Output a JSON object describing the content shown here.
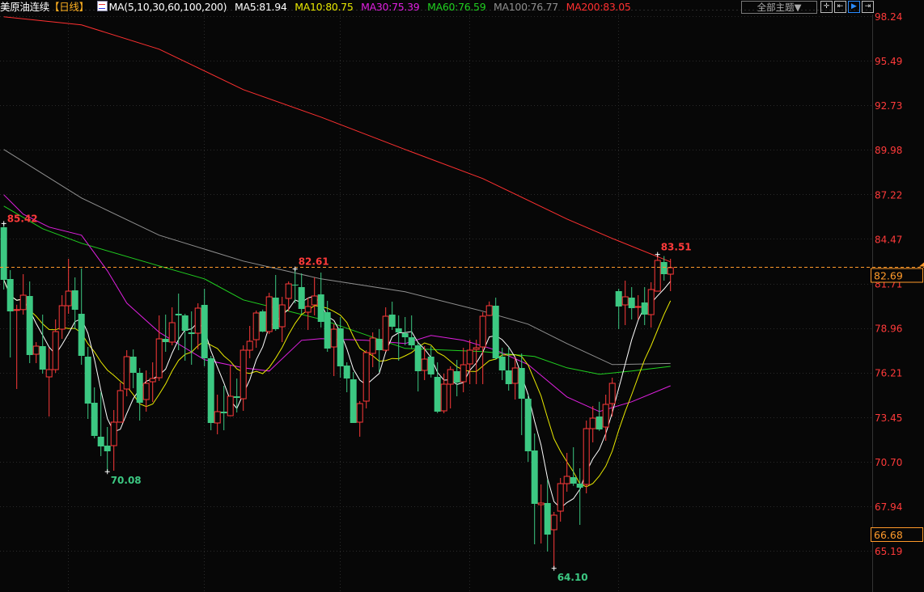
{
  "header": {
    "instrument": "美原油连续",
    "period": "【日线】",
    "ma_icon": "ma-indicator-icon",
    "ma_params": "MA(5,10,30,60,100,200)",
    "ma5": "MA5:81.94",
    "ma10": "MA10:80.75",
    "ma30": "MA30:75.39",
    "ma60": "MA60:76.59",
    "ma100": "MA100:76.77",
    "ma200": "MA200:83.05"
  },
  "toolbar": {
    "theme_label": "全部主题▼",
    "buttons": [
      {
        "icon": "crosshair-icon",
        "glyph": "✛"
      },
      {
        "icon": "fit-range-icon",
        "glyph": "⇤"
      },
      {
        "icon": "play-forward-icon",
        "glyph": "▶"
      },
      {
        "icon": "jump-to-end-icon",
        "glyph": "⇥"
      }
    ]
  },
  "colors": {
    "up": "#ff3a3a",
    "down": "#3cc882",
    "ma5": "#ffffff",
    "ma10": "#e8e800",
    "ma30": "#e020e0",
    "ma60": "#20d020",
    "ma100": "#909090",
    "ma200": "#ff3030",
    "axis": "#ff3a3a",
    "current": "#ff9a2a"
  },
  "chart_data": {
    "type": "candlestick",
    "yticks": [
      "98.24",
      "95.49",
      "92.73",
      "89.98",
      "87.22",
      "84.47",
      "81.71",
      "78.96",
      "76.21",
      "73.45",
      "70.70",
      "67.94",
      "65.19"
    ],
    "ylim": [
      64.0,
      98.24
    ],
    "grid": true,
    "current_price": "82.69",
    "current_line_value": 82.74,
    "marker_price": "66.68",
    "annotations": [
      {
        "text": "85.42",
        "index": 0,
        "value": 85.42,
        "kind": "high"
      },
      {
        "text": "70.08",
        "index": 16,
        "value": 70.08,
        "kind": "low"
      },
      {
        "text": "82.61",
        "index": 45,
        "value": 82.61,
        "kind": "high"
      },
      {
        "text": "64.10",
        "index": 85,
        "value": 64.1,
        "kind": "low"
      },
      {
        "text": "83.51",
        "index": 101,
        "value": 83.51,
        "kind": "high"
      }
    ],
    "ohlc": [
      [
        85.19,
        85.42,
        81.34,
        81.94
      ],
      [
        81.99,
        82.54,
        77.14,
        79.99
      ],
      [
        80.1,
        80.4,
        75.19,
        80.1
      ],
      [
        80.1,
        82.29,
        79.79,
        80.99
      ],
      [
        80.94,
        81.84,
        76.79,
        77.29
      ],
      [
        77.34,
        78.09,
        76.79,
        77.84
      ],
      [
        77.84,
        79.79,
        76.14,
        76.39
      ],
      [
        75.94,
        77.74,
        73.49,
        76.39
      ],
      [
        76.39,
        79.49,
        76.19,
        78.74
      ],
      [
        78.89,
        80.99,
        78.29,
        80.34
      ],
      [
        80.34,
        83.24,
        79.84,
        81.24
      ],
      [
        81.29,
        82.09,
        78.89,
        80.09
      ],
      [
        79.84,
        82.64,
        76.69,
        77.24
      ],
      [
        77.19,
        77.79,
        73.34,
        74.29
      ],
      [
        74.34,
        75.29,
        72.14,
        72.29
      ],
      [
        72.24,
        74.99,
        71.04,
        71.64
      ],
      [
        71.69,
        72.84,
        70.08,
        71.34
      ],
      [
        71.69,
        73.89,
        70.14,
        73.14
      ],
      [
        73.14,
        75.59,
        73.14,
        75.09
      ],
      [
        75.19,
        77.59,
        74.74,
        77.19
      ],
      [
        77.19,
        77.64,
        75.24,
        76.19
      ],
      [
        76.19,
        76.49,
        73.24,
        74.34
      ],
      [
        74.54,
        76.34,
        73.79,
        75.54
      ],
      [
        75.64,
        76.84,
        74.39,
        75.84
      ],
      [
        75.89,
        79.74,
        75.69,
        78.29
      ],
      [
        78.29,
        79.79,
        77.49,
        78.09
      ],
      [
        78.09,
        80.24,
        77.89,
        79.29
      ],
      [
        79.84,
        81.09,
        77.59,
        79.74
      ],
      [
        79.74,
        79.84,
        76.94,
        78.79
      ],
      [
        78.69,
        79.99,
        76.69,
        78.59
      ],
      [
        78.64,
        80.49,
        77.64,
        80.19
      ],
      [
        80.39,
        81.39,
        76.59,
        77.09
      ],
      [
        77.09,
        77.24,
        72.64,
        73.09
      ],
      [
        73.09,
        74.84,
        72.39,
        73.79
      ],
      [
        73.79,
        75.39,
        72.64,
        73.69
      ],
      [
        73.54,
        76.64,
        73.5,
        74.74
      ],
      [
        74.74,
        75.84,
        73.74,
        74.64
      ],
      [
        74.59,
        77.89,
        73.84,
        77.59
      ],
      [
        77.59,
        79.09,
        77.09,
        78.14
      ],
      [
        78.24,
        80.04,
        77.74,
        79.89
      ],
      [
        79.99,
        80.1,
        78.7,
        78.74
      ],
      [
        78.74,
        81.14,
        78.59,
        80.89
      ],
      [
        80.84,
        82.24,
        78.79,
        78.89
      ],
      [
        79.04,
        80.89,
        78.09,
        80.39
      ],
      [
        80.79,
        81.84,
        79.99,
        81.69
      ],
      [
        81.64,
        82.61,
        80.49,
        81.59
      ],
      [
        81.49,
        82.34,
        79.84,
        80.14
      ],
      [
        79.94,
        80.84,
        78.84,
        80.29
      ],
      [
        80.39,
        82.09,
        79.74,
        80.94
      ],
      [
        81.04,
        82.39,
        78.99,
        79.34
      ],
      [
        79.94,
        80.64,
        77.49,
        77.69
      ],
      [
        77.79,
        79.19,
        75.99,
        78.89
      ],
      [
        78.94,
        79.64,
        75.89,
        76.59
      ],
      [
        76.64,
        76.84,
        74.99,
        75.84
      ],
      [
        75.79,
        76.24,
        73.09,
        73.09
      ],
      [
        73.14,
        74.44,
        72.24,
        74.29
      ],
      [
        74.44,
        77.59,
        73.99,
        77.44
      ],
      [
        77.39,
        78.69,
        76.54,
        78.34
      ],
      [
        78.29,
        78.89,
        76.24,
        77.59
      ],
      [
        77.59,
        80.24,
        77.5,
        79.69
      ],
      [
        79.79,
        80.59,
        78.84,
        79.04
      ],
      [
        78.94,
        79.74,
        76.94,
        78.69
      ],
      [
        78.64,
        79.64,
        77.9,
        78.39
      ],
      [
        78.39,
        79.74,
        77.7,
        77.89
      ],
      [
        77.89,
        78.04,
        75.04,
        76.29
      ],
      [
        76.34,
        77.84,
        75.74,
        77.04
      ],
      [
        77.19,
        77.84,
        75.9,
        76.09
      ],
      [
        75.94,
        76.84,
        73.7,
        73.79
      ],
      [
        73.84,
        76.14,
        73.69,
        75.49
      ],
      [
        75.49,
        76.59,
        73.99,
        76.39
      ],
      [
        76.29,
        76.99,
        74.74,
        75.59
      ],
      [
        75.64,
        77.74,
        74.99,
        76.69
      ],
      [
        76.74,
        78.24,
        75.49,
        77.59
      ],
      [
        77.64,
        78.24,
        75.49,
        77.74
      ],
      [
        77.79,
        79.94,
        75.49,
        79.69
      ],
      [
        79.74,
        80.6,
        79.7,
        80.34
      ],
      [
        80.34,
        80.84,
        77.0,
        77.09
      ],
      [
        77.19,
        77.74,
        75.74,
        76.34
      ],
      [
        76.34,
        77.74,
        75.09,
        75.49
      ],
      [
        75.54,
        77.14,
        74.54,
        76.49
      ],
      [
        76.49,
        77.39,
        72.34,
        74.59
      ],
      [
        74.59,
        74.84,
        70.69,
        71.34
      ],
      [
        71.39,
        72.44,
        65.59,
        68.09
      ],
      [
        68.04,
        69.29,
        65.64,
        68.14
      ],
      [
        68.14,
        69.59,
        65.14,
        66.19
      ],
      [
        66.49,
        67.59,
        64.1,
        67.39
      ],
      [
        67.64,
        69.69,
        66.99,
        69.34
      ],
      [
        69.34,
        71.24,
        68.84,
        69.79
      ],
      [
        69.74,
        71.59,
        69.2,
        69.34
      ],
      [
        69.34,
        70.29,
        66.79,
        69.09
      ],
      [
        69.29,
        73.24,
        68.74,
        72.74
      ],
      [
        72.74,
        74.14,
        71.89,
        73.39
      ],
      [
        73.49,
        74.4,
        72.6,
        72.69
      ],
      [
        72.84,
        74.84,
        71.99,
        74.24
      ],
      [
        74.29,
        75.89,
        73.49,
        75.54
      ],
      [
        81.24,
        81.39,
        78.89,
        80.29
      ],
      [
        80.39,
        81.89,
        79.14,
        80.89
      ],
      [
        80.84,
        81.49,
        79.49,
        80.19
      ],
      [
        80.24,
        80.99,
        79.49,
        80.29
      ],
      [
        80.54,
        81.49,
        79.14,
        79.79
      ],
      [
        79.79,
        81.79,
        78.99,
        81.34
      ],
      [
        81.24,
        83.51,
        81.24,
        83.14
      ],
      [
        83.04,
        83.41,
        81.89,
        82.29
      ],
      [
        82.29,
        83.24,
        81.24,
        82.69
      ]
    ],
    "ma_computed": [
      {
        "key": "ma5",
        "period": 5
      },
      {
        "key": "ma10",
        "period": 10
      }
    ],
    "ma_series": {
      "ma30": [
        [
          0,
          87.2
        ],
        [
          3,
          86.0
        ],
        [
          7,
          85.2
        ],
        [
          12,
          84.7
        ],
        [
          16,
          82.5
        ],
        [
          19,
          80.5
        ],
        [
          24,
          78.7
        ],
        [
          31,
          77.0
        ],
        [
          37,
          76.5
        ],
        [
          41,
          76.3
        ],
        [
          46,
          78.2
        ],
        [
          49,
          78.3
        ],
        [
          56,
          78.2
        ],
        [
          62,
          78.0
        ],
        [
          66,
          78.5
        ],
        [
          71,
          78.2
        ],
        [
          76,
          77.6
        ],
        [
          81,
          76.7
        ],
        [
          87,
          74.7
        ],
        [
          92,
          73.8
        ],
        [
          97,
          74.4
        ],
        [
          103,
          75.39
        ]
      ],
      "ma60": [
        [
          0,
          86.5
        ],
        [
          6,
          85.1
        ],
        [
          12,
          84.2
        ],
        [
          24,
          82.8
        ],
        [
          31,
          82.0
        ],
        [
          37,
          80.7
        ],
        [
          49,
          79.5
        ],
        [
          62,
          77.7
        ],
        [
          74,
          77.5
        ],
        [
          82,
          77.2
        ],
        [
          87,
          76.5
        ],
        [
          92,
          76.1
        ],
        [
          97,
          76.3
        ],
        [
          103,
          76.59
        ]
      ],
      "ma100": [
        [
          0,
          90.0
        ],
        [
          12,
          87.0
        ],
        [
          24,
          84.7
        ],
        [
          37,
          83.1
        ],
        [
          49,
          82.0
        ],
        [
          62,
          81.2
        ],
        [
          74,
          80.0
        ],
        [
          81,
          79.2
        ],
        [
          87,
          78.0
        ],
        [
          94,
          76.7
        ],
        [
          103,
          76.77
        ]
      ],
      "ma200": [
        [
          0,
          98.2
        ],
        [
          12,
          97.7
        ],
        [
          24,
          96.2
        ],
        [
          37,
          93.7
        ],
        [
          49,
          92.0
        ],
        [
          62,
          90.0
        ],
        [
          74,
          88.2
        ],
        [
          87,
          85.7
        ],
        [
          94,
          84.5
        ],
        [
          103,
          83.05
        ]
      ]
    }
  }
}
